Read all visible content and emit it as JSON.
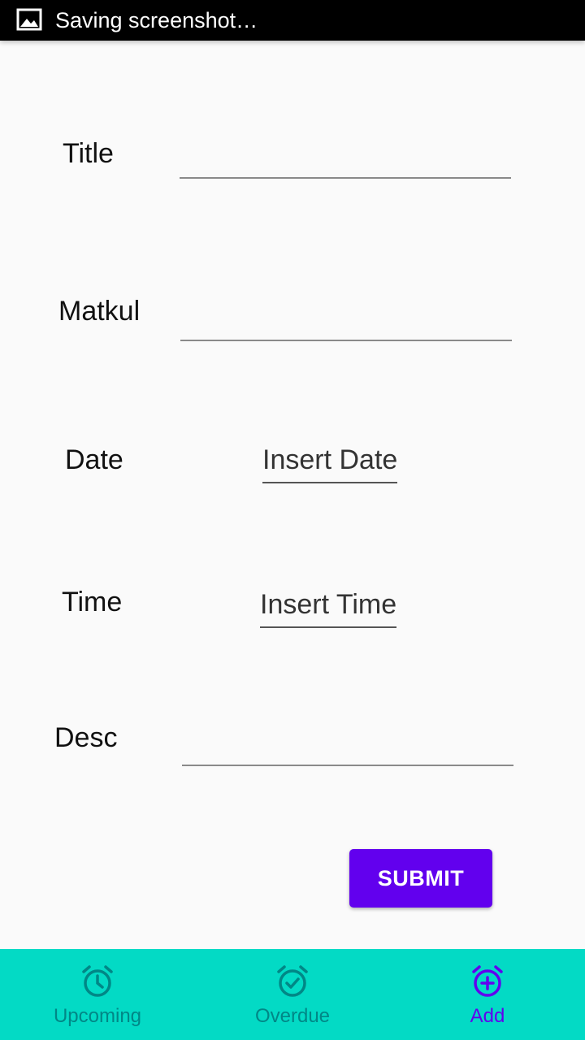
{
  "status_bar": {
    "text": "Saving screenshot…",
    "icon": "image-icon"
  },
  "form": {
    "title_label": "Title",
    "title_value": "",
    "matkul_label": "Matkul",
    "matkul_value": "",
    "date_label": "Date",
    "date_placeholder": "Insert Date",
    "time_label": "Time",
    "time_placeholder": "Insert Time",
    "desc_label": "Desc",
    "desc_value": "",
    "submit_label": "SUBMIT"
  },
  "bottom_nav": {
    "items": [
      {
        "label": "Upcoming",
        "icon": "alarm-clock-icon",
        "active": false
      },
      {
        "label": "Overdue",
        "icon": "alarm-check-icon",
        "active": false
      },
      {
        "label": "Add",
        "icon": "alarm-add-icon",
        "active": true
      }
    ]
  },
  "colors": {
    "status_bar": "#000000",
    "background": "#fafafa",
    "primary": "#6200ee",
    "nav_background": "#03dac5",
    "nav_inactive": "#018786"
  }
}
